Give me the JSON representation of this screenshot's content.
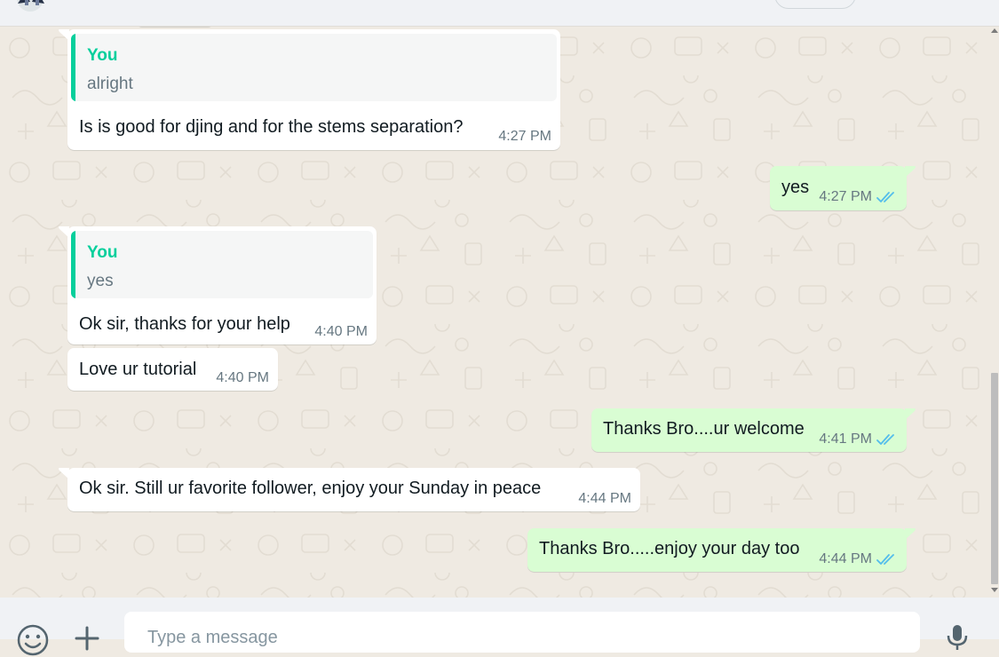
{
  "composer": {
    "placeholder": "Type a message",
    "emoji_icon": "smiley-icon",
    "attach_icon": "plus-icon",
    "mic_icon": "microphone-icon"
  },
  "colors": {
    "incoming_bubble": "#ffffff",
    "outgoing_bubble": "#d9fdd3",
    "quote_accent": "#06cf9c",
    "read_ticks": "#53bdeb",
    "chat_background": "#efeae2"
  },
  "messages": [
    {
      "direction": "incoming",
      "quote": {
        "author": "You",
        "text": "alright"
      },
      "text": "Is is good for djing and for the stems separation?",
      "time": "4:27 PM"
    },
    {
      "direction": "outgoing",
      "text": "yes",
      "time": "4:27 PM",
      "status": "read"
    },
    {
      "direction": "incoming",
      "quote": {
        "author": "You",
        "text": "yes"
      },
      "text": "Ok sir, thanks for your help",
      "time": "4:40 PM"
    },
    {
      "direction": "incoming",
      "text": "Love ur tutorial",
      "time": "4:40 PM"
    },
    {
      "direction": "outgoing",
      "text": "Thanks Bro....ur welcome",
      "time": "4:41 PM",
      "status": "read"
    },
    {
      "direction": "incoming",
      "text": "Ok sir. Still ur favorite follower, enjoy your Sunday in peace",
      "time": "4:44 PM"
    },
    {
      "direction": "outgoing",
      "text": "Thanks Bro.....enjoy your day too",
      "time": "4:44 PM",
      "status": "read"
    }
  ]
}
